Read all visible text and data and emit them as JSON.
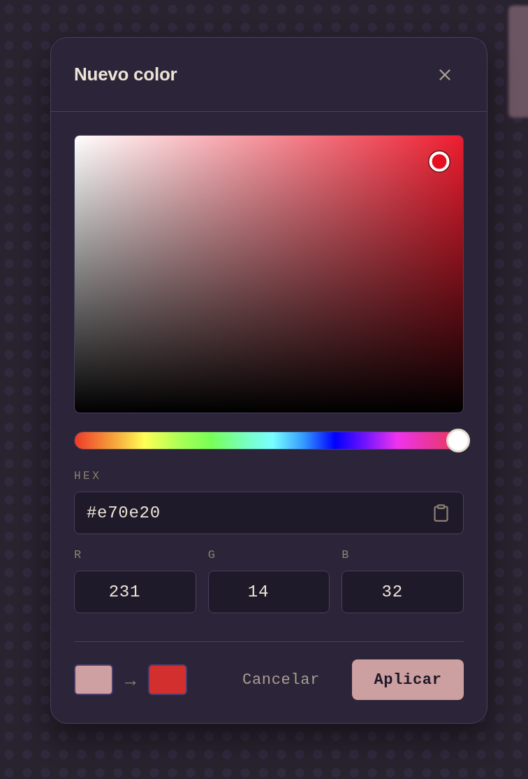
{
  "dialog": {
    "title": "Nuevo color"
  },
  "picker": {
    "hue": {
      "level": 0.985
    }
  },
  "hex": {
    "label": "HEX",
    "value": "#e70e20"
  },
  "channels": [
    {
      "label": "R",
      "value": "231"
    },
    {
      "label": "G",
      "value": "14"
    },
    {
      "label": "B",
      "value": "32"
    }
  ],
  "preview": {
    "swatches": [
      {
        "color": "#cfa0a2"
      },
      {
        "color": "#d42f2f"
      }
    ],
    "arrow": "→"
  },
  "buttons": [
    {
      "label": "Cancelar",
      "kind": "secondary"
    },
    {
      "label": "Aplicar",
      "kind": "primary"
    }
  ]
}
